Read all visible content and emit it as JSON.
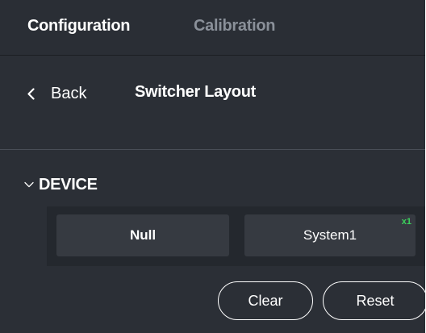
{
  "tabs": [
    {
      "label": "Configuration",
      "active": true
    },
    {
      "label": "Calibration",
      "active": false
    }
  ],
  "nav": {
    "back_label": "Back",
    "back_icon": "chevron-left-icon",
    "title": "Switcher Layout"
  },
  "section": {
    "title": "DEVICE",
    "expand_icon": "chevron-down-icon",
    "expanded": true
  },
  "devices": [
    {
      "label": "Null",
      "badge": ""
    },
    {
      "label": "System1",
      "badge": "x1"
    }
  ],
  "actions": {
    "clear_label": "Clear",
    "reset_label": "Reset"
  },
  "colors": {
    "background": "#2b2f36",
    "panel": "#24282e",
    "button": "#363a41",
    "inactive_tab": "#8a9099",
    "badge": "#3ad15b"
  }
}
